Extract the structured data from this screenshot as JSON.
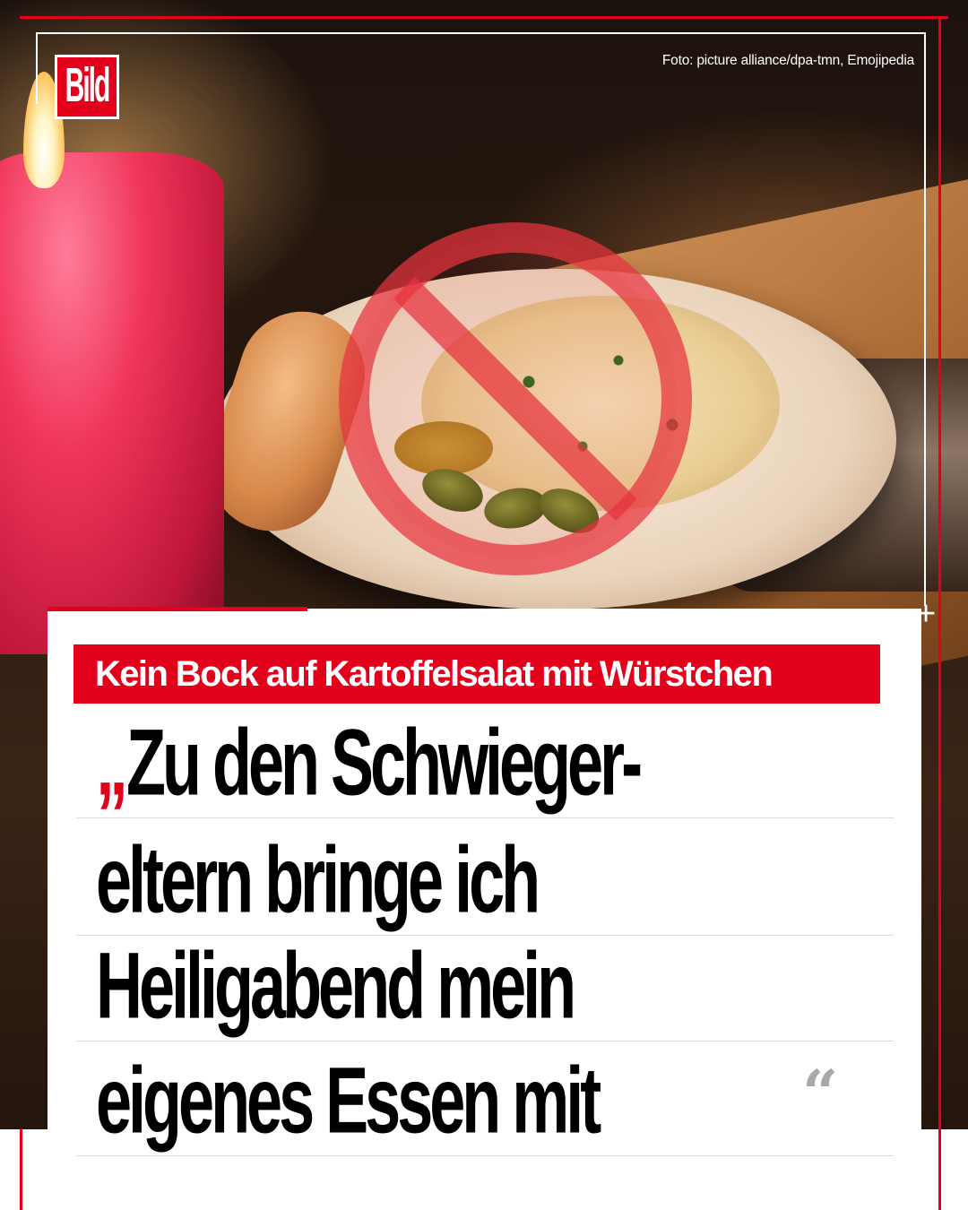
{
  "brand": {
    "logo_text": "Bild",
    "accent_color": "#e2001a"
  },
  "photo": {
    "credit": "Foto: picture alliance/dpa-tmn, Emojipedia",
    "overlay_icon": "prohibited-icon"
  },
  "kicker": "Kein Bock auf Kartoffelsalat mit Würstchen",
  "headline": {
    "open_quote": "„",
    "lines": [
      "Zu den Schwieger-",
      "eltern bringe ich",
      "Heiligabend mein",
      "eigenes Essen mit"
    ],
    "close_quote": "“"
  }
}
